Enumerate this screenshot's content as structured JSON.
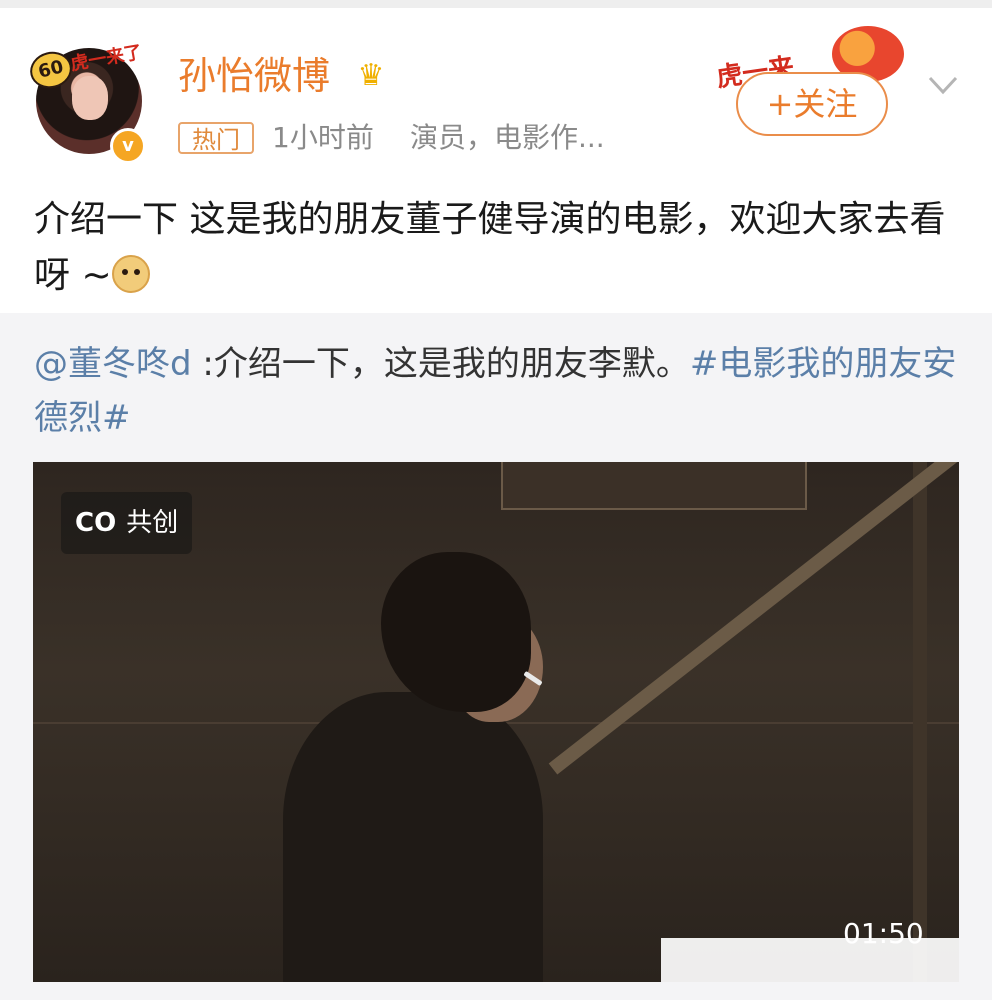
{
  "post": {
    "username": "孙怡微博",
    "hot_tag": "热门",
    "time": "1小时前",
    "source": "演员，电影作...",
    "follow_label": "+关注",
    "text": "介绍一下 这是我的朋友董子健导演的电影，欢迎大家去看呀 ~",
    "avatar_frame_text": "虎一来了",
    "avatar_badge": "60",
    "follow_deco_text": "虎一来"
  },
  "repost": {
    "mention": "@董冬咚d",
    "text_middle": " :介绍一下，这是我的朋友李默。",
    "hashtag": "#电影我的朋友安德烈#"
  },
  "video": {
    "co_logo": "CO",
    "co_label": "共创",
    "duration": "01:50"
  },
  "colors": {
    "brand_orange": "#ea7c2c",
    "link_blue": "#5b7fa8",
    "repost_bg": "#f4f4f6"
  },
  "icons": {
    "crown": "crown-icon",
    "verified": "verified-badge-icon",
    "chevron": "chevron-down-icon",
    "emoji": "doge-emoji-icon"
  }
}
